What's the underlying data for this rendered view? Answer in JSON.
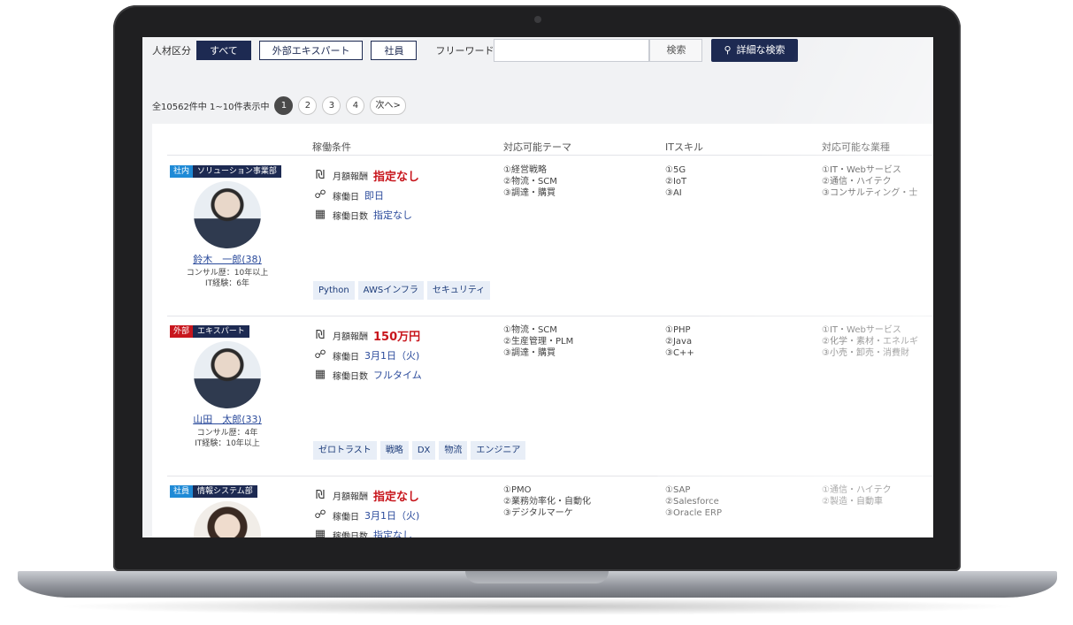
{
  "filter": {
    "label": "人材区分",
    "buttons": [
      {
        "label": "すべて",
        "active": true
      },
      {
        "label": "外部エキスパート",
        "active": false
      },
      {
        "label": "社員",
        "active": false
      }
    ],
    "freeword_label": "フリーワード",
    "freeword_value": "",
    "search_label": "検索",
    "advanced_label": "詳細な検索"
  },
  "pager": {
    "summary": "全10562件中 1~10件表示中",
    "pages": [
      "1",
      "2",
      "3",
      "4"
    ],
    "current": "1",
    "next": "次へ>"
  },
  "columns": {
    "conditions": "稼働条件",
    "themes": "対応可能テーマ",
    "skills": "ITスキル",
    "industries": "対応可能な業種"
  },
  "condition_labels": {
    "fee": "月額報酬",
    "start": "稼働日",
    "days": "稼働日数"
  },
  "icons": {
    "fee": "money-icon",
    "start": "handshake-icon",
    "days": "calendar-icon",
    "search": "search-icon"
  },
  "colors": {
    "navy": "#1d2a52",
    "internal_badge": "#1f8ad6",
    "external_badge": "#c8161d",
    "fee_red": "#c8161d",
    "link_blue": "#2a4a9b"
  },
  "people": [
    {
      "kind": "社内",
      "kind_color": "#1f8ad6",
      "dept": "ソリューション事業部",
      "name": "鈴木　一郎(38)",
      "consul": "コンサル歴：10年以上",
      "it": "IT経験：6年",
      "fee": "指定なし",
      "start": "即日",
      "days": "指定なし",
      "themes": [
        "①経営戦略",
        "②物流・SCM",
        "③調達・購買"
      ],
      "skills": [
        "①5G",
        "②IoT",
        "③AI"
      ],
      "industries": [
        "①IT・Webサービス",
        "②通信・ハイテク",
        "③コンサルティング・士"
      ],
      "tags": [
        "Python",
        "AWSインフラ",
        "セキュリティ"
      ]
    },
    {
      "kind": "外部",
      "kind_color": "#c8161d",
      "dept": "エキスパート",
      "name": "山田　太郎(33)",
      "consul": "コンサル歴：4年",
      "it": "IT経験：10年以上",
      "fee": "150万円",
      "start": "3月1日（火)",
      "days": "フルタイム",
      "themes": [
        "①物流・SCM",
        "②生産管理・PLM",
        "③調達・購買"
      ],
      "skills": [
        "①PHP",
        "②Java",
        "③C++"
      ],
      "industries": [
        "①IT・Webサービス",
        "②化学・素材・エネルギ",
        "③小売・卸売・消費財"
      ],
      "tags": [
        "ゼロトラスト",
        "戦略",
        "DX",
        "物流",
        "エンジニア"
      ]
    },
    {
      "kind": "社員",
      "kind_color": "#1f8ad6",
      "dept": "情報システム部",
      "fee": "指定なし",
      "start": "3月1日（火)",
      "days": "指定なし",
      "themes": [
        "①PMO",
        "②業務効率化・自動化",
        "③デジタルマーケ"
      ],
      "skills": [
        "①SAP",
        "②Salesforce",
        "③Oracle ERP"
      ],
      "industries": [
        "①通信・ハイテク",
        "②製造・自動車"
      ]
    }
  ]
}
